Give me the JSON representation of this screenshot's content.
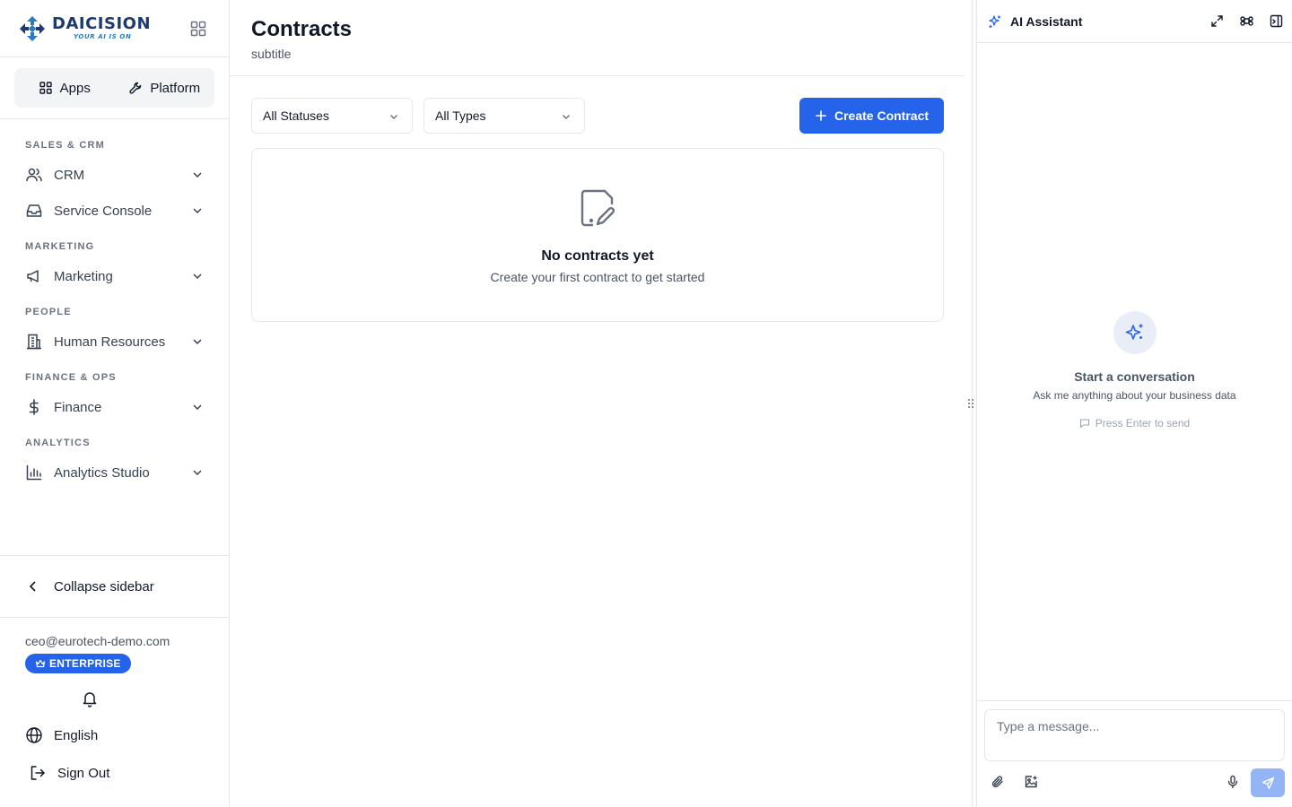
{
  "brand": {
    "name": "DAICISION",
    "tagline": "YOUR AI IS ON"
  },
  "switcher": {
    "apps_label": "Apps",
    "platform_label": "Platform"
  },
  "nav": [
    {
      "section": "SALES & CRM",
      "items": [
        {
          "label": "CRM",
          "icon": "users-icon"
        },
        {
          "label": "Service Console",
          "icon": "inbox-icon"
        }
      ]
    },
    {
      "section": "MARKETING",
      "items": [
        {
          "label": "Marketing",
          "icon": "megaphone-icon"
        }
      ]
    },
    {
      "section": "PEOPLE",
      "items": [
        {
          "label": "Human Resources",
          "icon": "building-icon"
        }
      ]
    },
    {
      "section": "FINANCE & OPS",
      "items": [
        {
          "label": "Finance",
          "icon": "dollar-icon"
        }
      ]
    },
    {
      "section": "ANALYTICS",
      "items": [
        {
          "label": "Analytics Studio",
          "icon": "bar-chart-icon"
        }
      ]
    }
  ],
  "sidebar_bottom": {
    "collapse_label": "Collapse sidebar",
    "user_email": "ceo@eurotech-demo.com",
    "plan_badge": "ENTERPRISE",
    "language": "English",
    "sign_out": "Sign Out"
  },
  "page": {
    "title": "Contracts",
    "subtitle": "subtitle",
    "status_filter": "All Statuses",
    "type_filter": "All Types",
    "create_button": "Create Contract",
    "empty_title": "No contracts yet",
    "empty_subtitle": "Create your first contract to get started"
  },
  "assistant": {
    "title": "AI Assistant",
    "empty_title": "Start a conversation",
    "empty_subtitle": "Ask me anything about your business data",
    "hint": "Press Enter to send",
    "input_placeholder": "Type a message..."
  },
  "colors": {
    "accent": "#2563eb",
    "border": "#e5e7eb",
    "muted_text": "#4b5563",
    "send_disabled": "#93b4f5"
  }
}
